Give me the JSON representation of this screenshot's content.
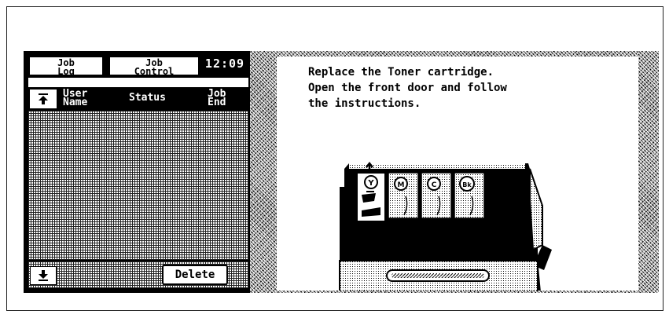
{
  "tabs": {
    "job_log": [
      "Job",
      "Log"
    ],
    "job_control": [
      "Job",
      "Control"
    ]
  },
  "clock": "12:09",
  "list_header": {
    "user_name": [
      "User",
      "Name"
    ],
    "status": "Status",
    "job_end": [
      "Job",
      "End"
    ]
  },
  "buttons": {
    "delete": "Delete"
  },
  "icons": {
    "scroll_up": "scroll-up-double-arrow-icon",
    "scroll_down": "scroll-down-double-arrow-icon",
    "toner_arrow": "up-arrow-icon"
  },
  "message": {
    "line1": "Replace the Toner cartridge.",
    "line2": "Open the front door and follow",
    "line3": "the instructions."
  },
  "toner_labels": [
    "Y",
    "M",
    "C",
    "Bk"
  ]
}
